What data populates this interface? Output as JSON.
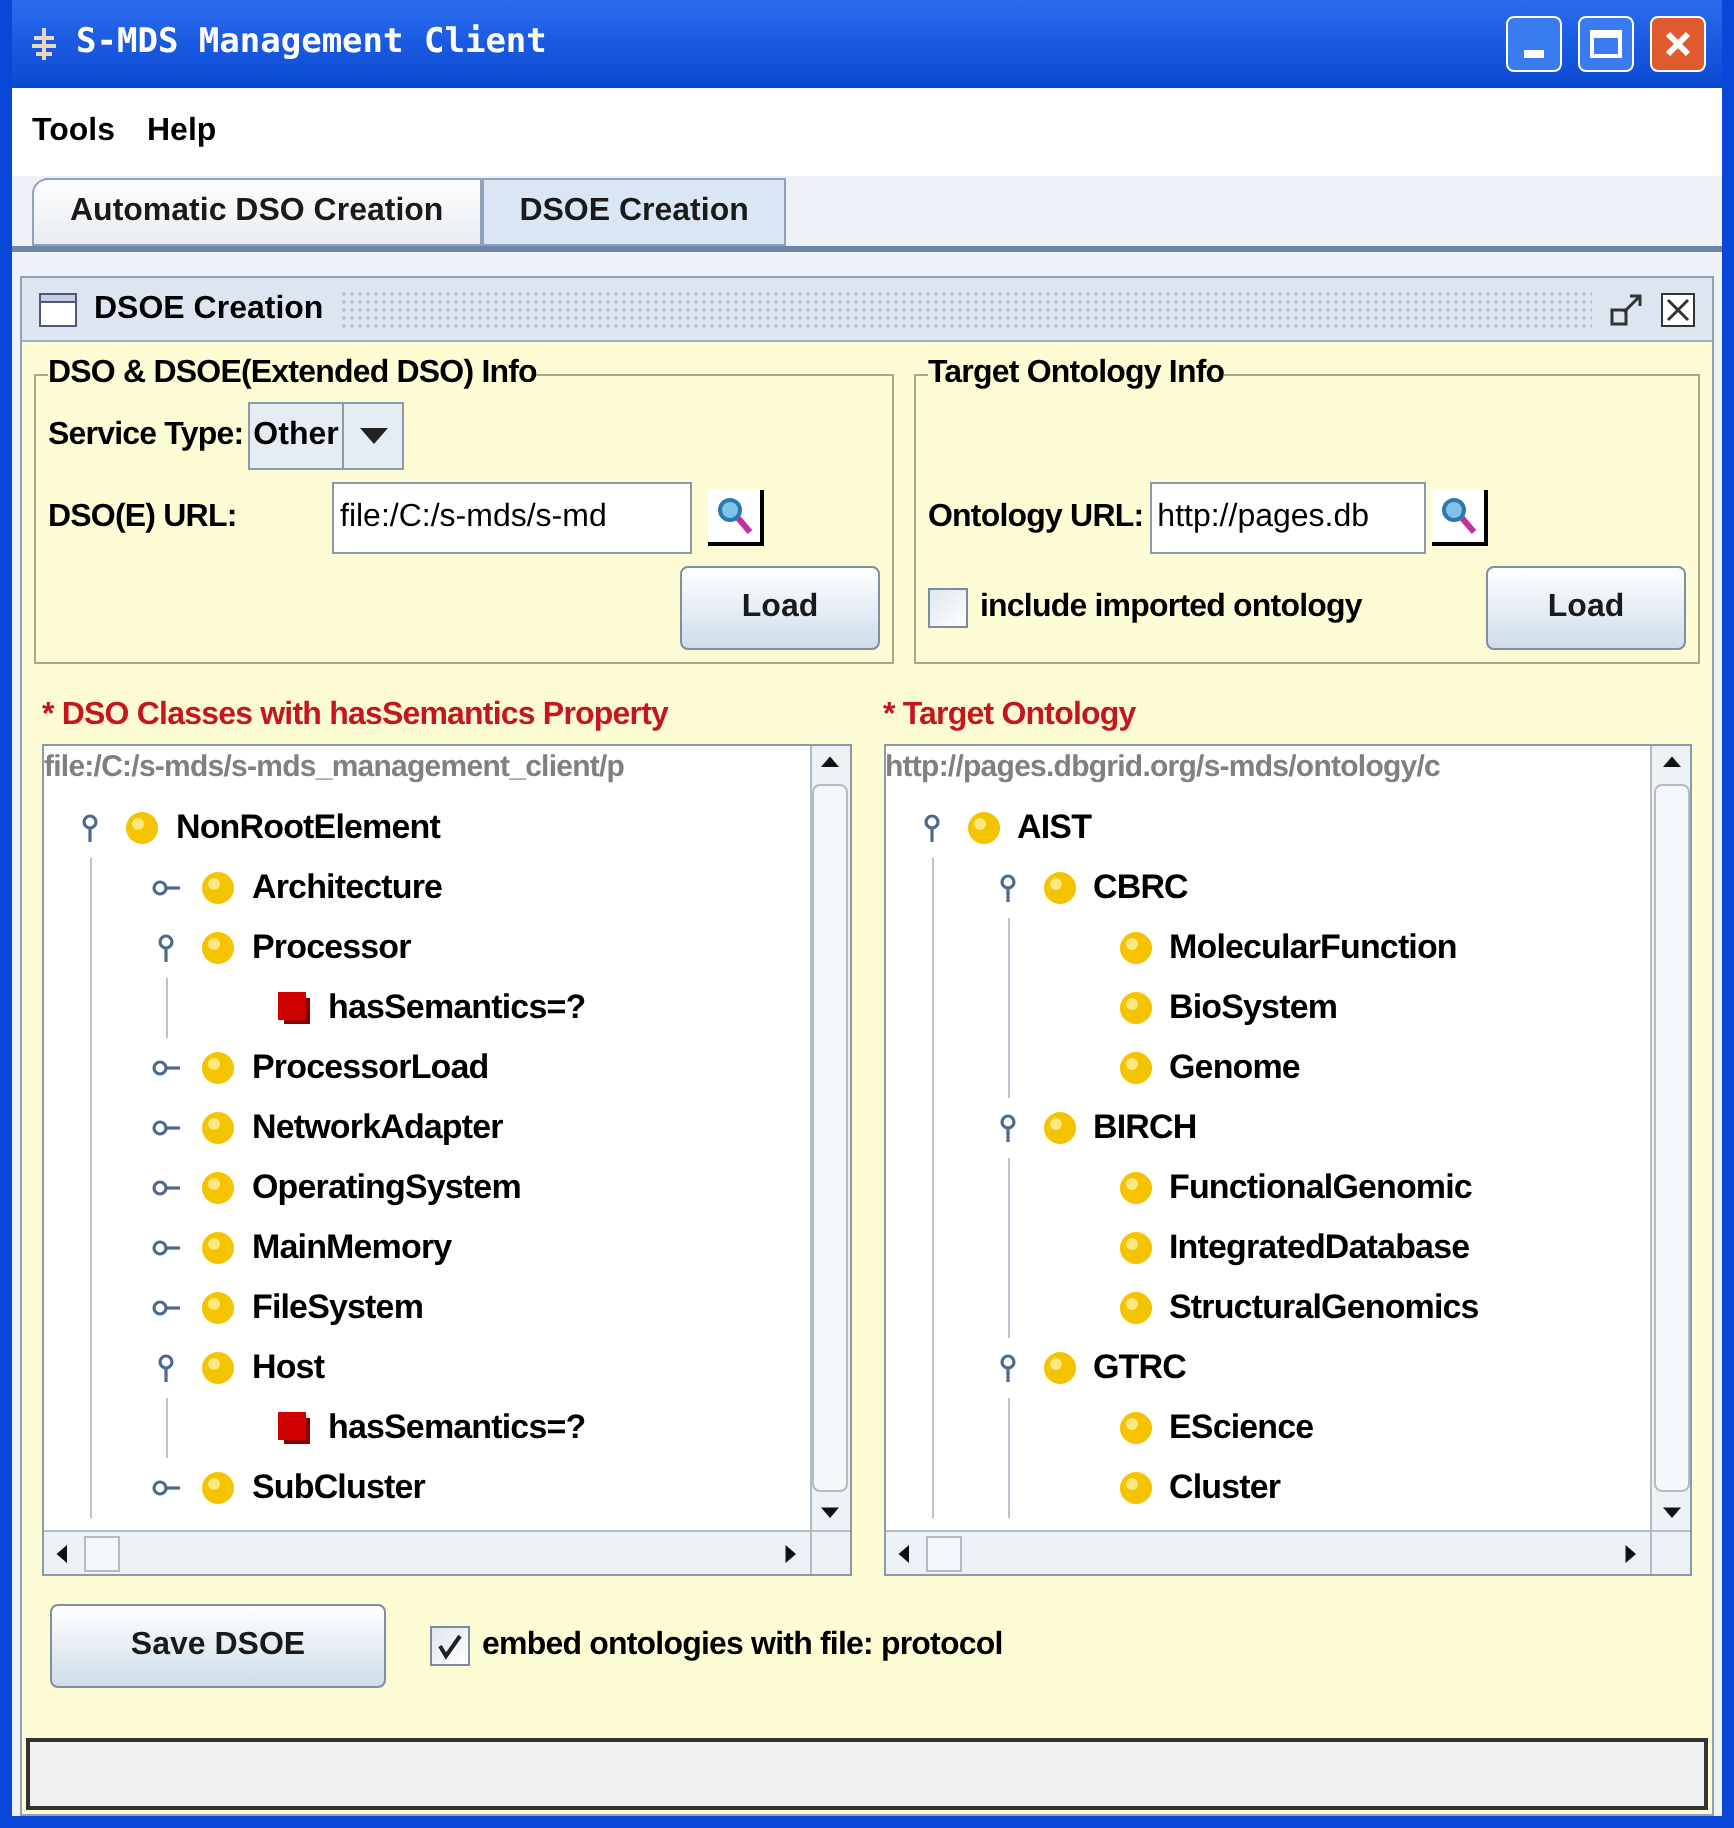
{
  "window": {
    "title": "S-MDS Management Client"
  },
  "menu": [
    "Tools",
    "Help"
  ],
  "tabs": [
    {
      "label": "Automatic DSO Creation",
      "selected": false
    },
    {
      "label": "DSOE Creation",
      "selected": true
    }
  ],
  "frame": {
    "title": "DSOE Creation"
  },
  "dso_info": {
    "title": "DSO & DSOE(Extended DSO) Info",
    "service_type_label": "Service Type:",
    "service_type": "Other",
    "url_label": "DSO(E) URL:",
    "url": "file:/C:/s-mds/s-md",
    "load": "Load"
  },
  "ontology_info": {
    "title": "Target Ontology Info",
    "url_label": "Ontology URL:",
    "url": "http://pages.db",
    "include_imported": {
      "label": "include imported ontology",
      "checked": false
    },
    "load": "Load"
  },
  "dso_tree": {
    "title": "DSO Classes with hasSemantics Property",
    "required_mark": "*",
    "path": "file:/C:/s-mds/s-mds_management_client/p",
    "nodes": [
      {
        "label": "NonRootElement",
        "kind": "class",
        "expanded": true,
        "children": [
          {
            "label": "Architecture",
            "kind": "class",
            "expanded": false
          },
          {
            "label": "Processor",
            "kind": "class",
            "expanded": true,
            "children": [
              {
                "label": "hasSemantics=?",
                "kind": "property"
              }
            ]
          },
          {
            "label": "ProcessorLoad",
            "kind": "class",
            "expanded": false
          },
          {
            "label": "NetworkAdapter",
            "kind": "class",
            "expanded": false
          },
          {
            "label": "OperatingSystem",
            "kind": "class",
            "expanded": false
          },
          {
            "label": "MainMemory",
            "kind": "class",
            "expanded": false
          },
          {
            "label": "FileSystem",
            "kind": "class",
            "expanded": false
          },
          {
            "label": "Host",
            "kind": "class",
            "expanded": true,
            "children": [
              {
                "label": "hasSemantics=?",
                "kind": "property"
              }
            ]
          },
          {
            "label": "SubCluster",
            "kind": "class",
            "expanded": false
          }
        ]
      }
    ]
  },
  "ontology_tree": {
    "title": "Target Ontology",
    "required_mark": "*",
    "path": "http://pages.dbgrid.org/s-mds/ontology/c",
    "nodes": [
      {
        "label": "AIST",
        "kind": "class",
        "expanded": true,
        "children": [
          {
            "label": "CBRC",
            "kind": "class",
            "expanded": true,
            "children": [
              {
                "label": "MolecularFunction",
                "kind": "class"
              },
              {
                "label": "BioSystem",
                "kind": "class"
              },
              {
                "label": "Genome",
                "kind": "class"
              }
            ]
          },
          {
            "label": "BIRCH",
            "kind": "class",
            "expanded": true,
            "children": [
              {
                "label": "FunctionalGenomic",
                "kind": "class"
              },
              {
                "label": "IntegratedDatabase",
                "kind": "class"
              },
              {
                "label": "StructuralGenomics",
                "kind": "class"
              }
            ]
          },
          {
            "label": "GTRC",
            "kind": "class",
            "expanded": true,
            "children": [
              {
                "label": "EScience",
                "kind": "class"
              },
              {
                "label": "Cluster",
                "kind": "class"
              }
            ]
          }
        ]
      }
    ]
  },
  "save_button": "Save DSOE",
  "embed": {
    "label": "embed ontologies with file: protocol",
    "checked": true
  }
}
